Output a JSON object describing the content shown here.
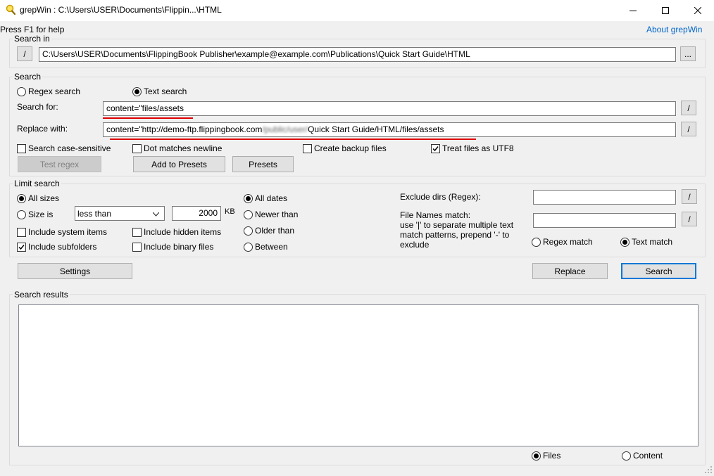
{
  "window": {
    "title": "grepWin : C:\\Users\\USER\\Documents\\Flippin...\\HTML"
  },
  "help_text": "Press F1 for help",
  "about_link": "About grepWin",
  "search_in": {
    "label": "Search in",
    "slash": "/",
    "path": "C:\\Users\\USER\\Documents\\FlippingBook Publisher\\example@example.com\\Publications\\Quick Start Guide\\HTML",
    "browse": "..."
  },
  "search": {
    "label": "Search",
    "regex_search": "Regex search",
    "text_search": "Text search",
    "search_for_label": "Search for:",
    "search_for_value": "content=\"files/assets",
    "replace_with_label": "Replace with:",
    "replace_prefix": "content=\"http://demo-ftp.flippingbook.com",
    "replace_blurred": "/public/user/",
    "replace_suffix": "Quick Start Guide/HTML/files/assets",
    "slash": "/",
    "case_sensitive": "Search case-sensitive",
    "dot_newline": "Dot matches newline",
    "backup_files": "Create backup files",
    "utf8": "Treat files as UTF8",
    "test_regex": "Test regex",
    "add_presets": "Add to Presets",
    "presets": "Presets"
  },
  "limit": {
    "label": "Limit search",
    "all_sizes": "All sizes",
    "size_is": "Size is",
    "size_op": "less than",
    "size_value": "2000",
    "size_unit": "KB",
    "system_items": "Include system items",
    "hidden_items": "Include hidden items",
    "subfolders": "Include subfolders",
    "binary_files": "Include binary files",
    "all_dates": "All dates",
    "newer_than": "Newer than",
    "older_than": "Older than",
    "between": "Between",
    "exclude_dirs": "Exclude dirs (Regex):",
    "file_names_match": "File Names match:",
    "file_names_hint": "use '|' to separate multiple text match patterns, prepend '-' to exclude",
    "regex_match": "Regex match",
    "text_match": "Text match",
    "slash": "/"
  },
  "buttons": {
    "settings": "Settings",
    "replace": "Replace",
    "search": "Search"
  },
  "results": {
    "label": "Search results",
    "files": "Files",
    "content": "Content"
  },
  "colors": {
    "accent": "#0078d7",
    "link": "#0066cc",
    "annotation": "#e00000"
  }
}
